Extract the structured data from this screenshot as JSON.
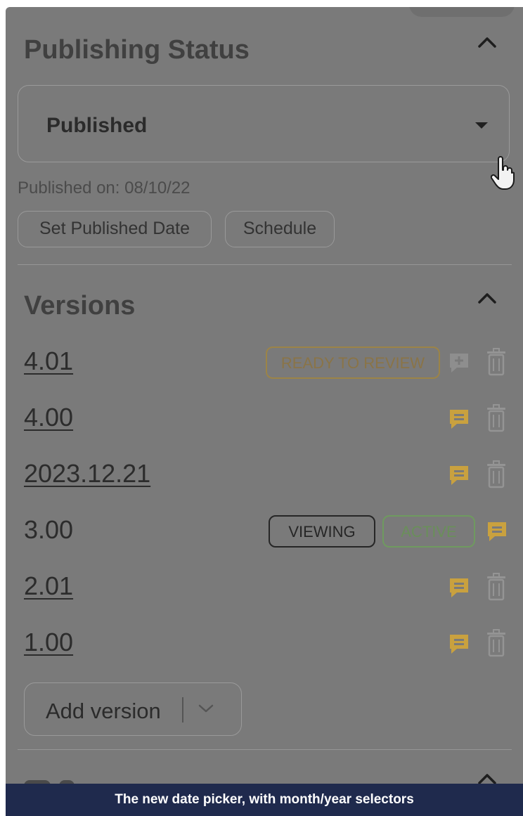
{
  "publishing": {
    "title": "Publishing Status",
    "status_value": "Published",
    "published_on": "Published on: 08/10/22",
    "set_date_label": "Set Published Date",
    "schedule_label": "Schedule"
  },
  "versions": {
    "title": "Versions",
    "items": [
      {
        "label": "4.01",
        "badges": [
          "READY TO REVIEW"
        ]
      },
      {
        "label": "4.00",
        "badges": []
      },
      {
        "label": "2023.12.21",
        "badges": []
      },
      {
        "label": "3.00",
        "badges": [
          "VIEWING",
          "ACTIVE"
        ]
      },
      {
        "label": "2.01",
        "badges": []
      },
      {
        "label": "1.00",
        "badges": []
      }
    ],
    "add_label": "Add version"
  },
  "caption": "The new date picker, with month/year selectors",
  "colors": {
    "overlay": "#7a7a7a",
    "comment_yellow": "#c9a13f",
    "review_border": "#9c8447",
    "active_border": "#6f9a5f",
    "caption_bg": "#1f2a4d"
  },
  "icons": [
    "chevron-up-icon",
    "caret-down-icon",
    "hand-pointer-icon",
    "add-comment-icon",
    "comment-icon",
    "trash-icon",
    "chevron-down-icon"
  ]
}
